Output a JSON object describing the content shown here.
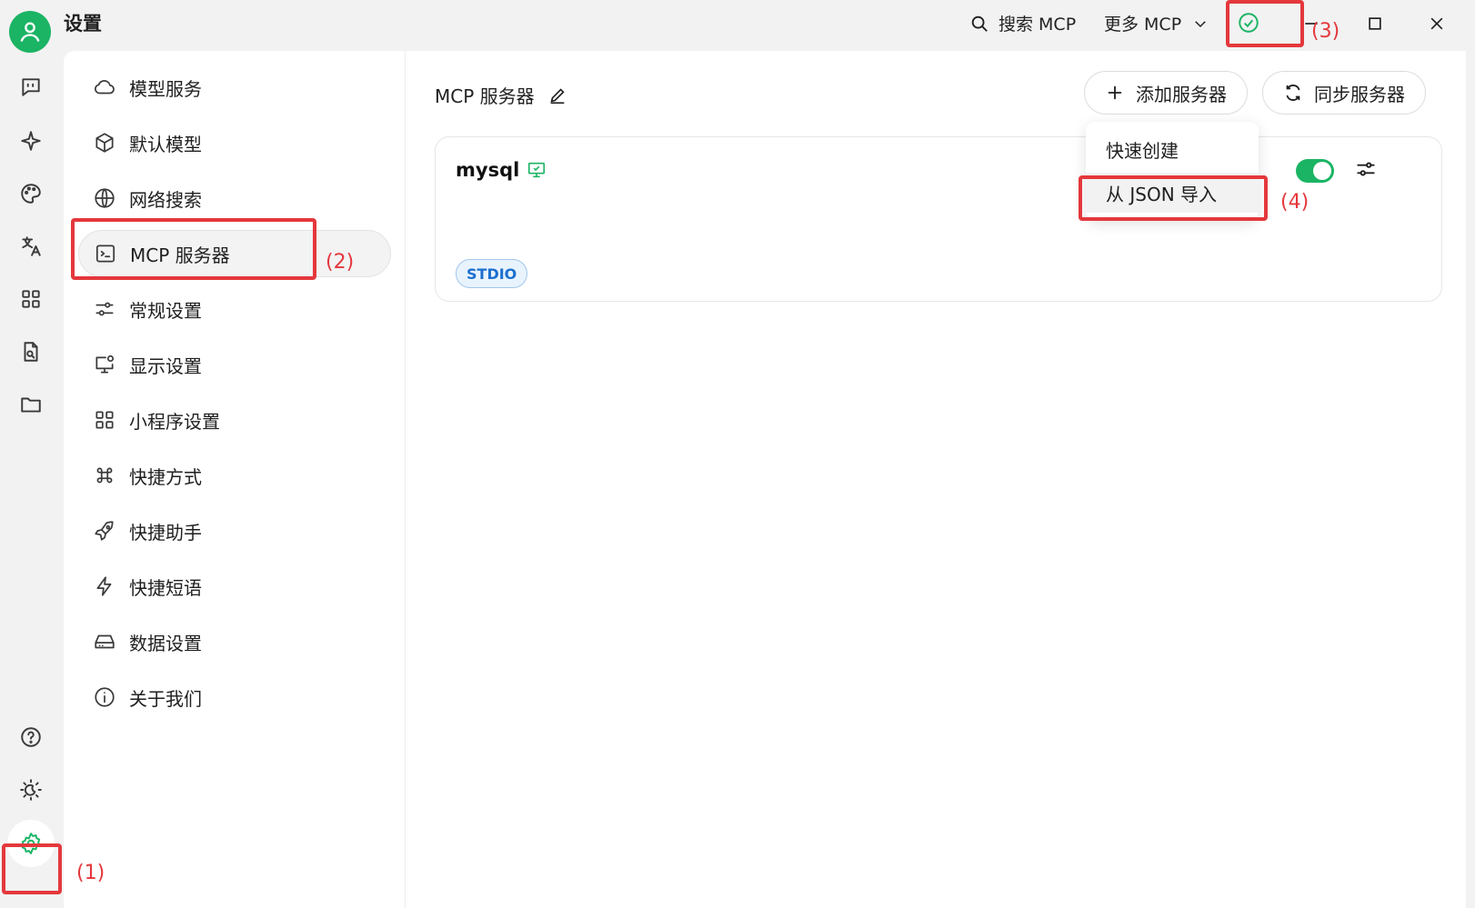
{
  "app": {
    "title": "设置"
  },
  "titlebar": {
    "search_label": "搜索 MCP",
    "more_label": "更多 MCP"
  },
  "settings_nav": [
    {
      "label": "模型服务",
      "icon": "cloud-icon"
    },
    {
      "label": "默认模型",
      "icon": "cube-icon"
    },
    {
      "label": "网络搜索",
      "icon": "globe-icon"
    },
    {
      "label": "MCP 服务器",
      "icon": "terminal-icon",
      "active": true
    },
    {
      "label": "常规设置",
      "icon": "sliders-icon"
    },
    {
      "label": "显示设置",
      "icon": "monitor-settings-icon"
    },
    {
      "label": "小程序设置",
      "icon": "grid-icon"
    },
    {
      "label": "快捷方式",
      "icon": "command-icon"
    },
    {
      "label": "快捷助手",
      "icon": "rocket-icon"
    },
    {
      "label": "快捷短语",
      "icon": "zap-icon"
    },
    {
      "label": "数据设置",
      "icon": "hard-drive-icon"
    },
    {
      "label": "关于我们",
      "icon": "info-icon"
    }
  ],
  "main": {
    "title": "MCP 服务器",
    "add_button": "添加服务器",
    "sync_button": "同步服务器",
    "dropdown": {
      "items": [
        "快速创建",
        "从 JSON 导入"
      ]
    },
    "server": {
      "name": "mysql",
      "type_badge": "STDIO",
      "enabled": true
    }
  },
  "annotations": [
    "(1)",
    "(2)",
    "(3)",
    "(4)"
  ],
  "colors": {
    "accent": "#1bb464",
    "annotation": "#e4383c",
    "badge_text": "#1b6fd0"
  }
}
